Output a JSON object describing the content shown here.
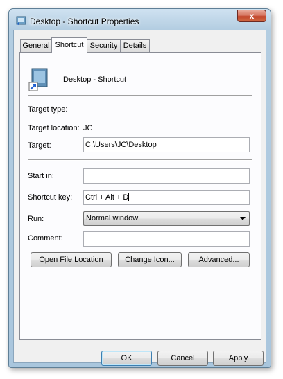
{
  "window": {
    "title": "Desktop - Shortcut Properties",
    "close_glyph": "x"
  },
  "tabs": [
    {
      "label": "General"
    },
    {
      "label": "Shortcut"
    },
    {
      "label": "Security"
    },
    {
      "label": "Details"
    }
  ],
  "active_tab": "Shortcut",
  "shortcut": {
    "name": "Desktop - Shortcut",
    "target_type_label": "Target type:",
    "target_type_value": "",
    "target_location_label": "Target location:",
    "target_location_value": "JC",
    "target_label": "Target:",
    "target_value": "C:\\Users\\JC\\Desktop",
    "start_in_label": "Start in:",
    "start_in_value": "",
    "shortcut_key_label": "Shortcut key:",
    "shortcut_key_value": "Ctrl + Alt + D",
    "run_label": "Run:",
    "run_value": "Normal window",
    "comment_label": "Comment:",
    "comment_value": "",
    "open_file_location_label": "Open File Location",
    "change_icon_label": "Change Icon...",
    "advanced_label": "Advanced..."
  },
  "footer": {
    "ok_label": "OK",
    "cancel_label": "Cancel",
    "apply_label": "Apply"
  },
  "colors": {
    "frame": "#a9c6dd",
    "close_button": "#c2452b",
    "panel": "#fcfcfe",
    "dialog": "#f0f0f0"
  },
  "icons": {
    "title": "shortcut-folder-icon",
    "shortcut": "desktop-shortcut-icon",
    "close": "close-icon",
    "dropdown": "chevron-down-icon"
  }
}
